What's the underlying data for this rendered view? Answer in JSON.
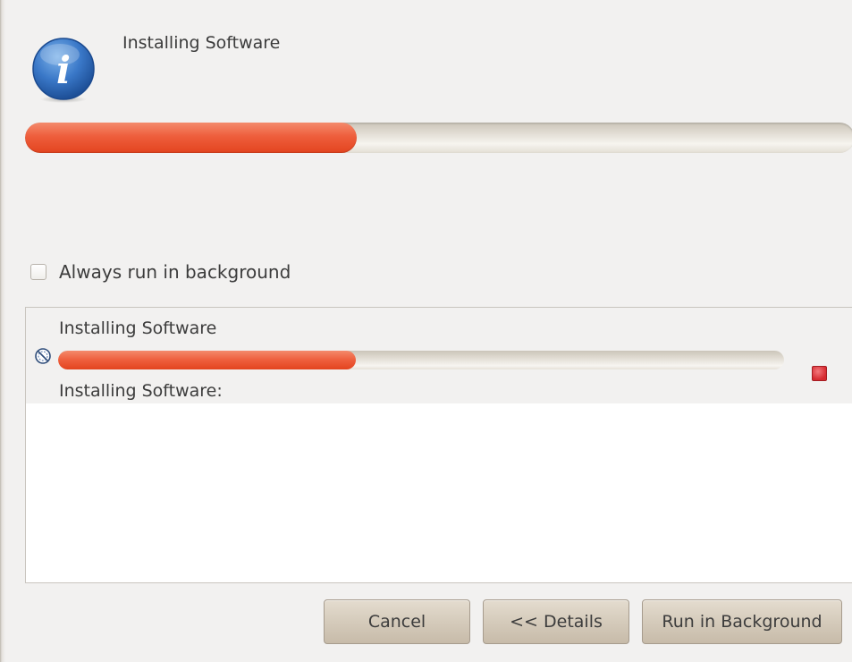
{
  "dialog": {
    "title": "Installing Software",
    "icon": "info-icon",
    "progress": 0.4,
    "accent_color": "#ee5e3c"
  },
  "options": {
    "always_background_label": "Always run in background",
    "always_background_checked": false
  },
  "details": {
    "jobs": [
      {
        "title": "Installing Software",
        "icon": "job-progress-icon",
        "progress": 0.41,
        "status": "Installing Software:",
        "stop_icon": "stop-icon"
      }
    ]
  },
  "buttons": {
    "cancel": "Cancel",
    "details": "<< Details",
    "run_background": "Run in Background"
  }
}
